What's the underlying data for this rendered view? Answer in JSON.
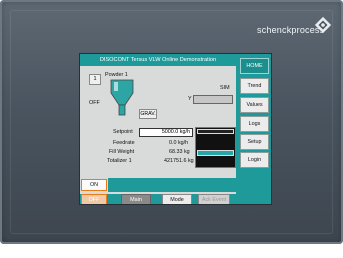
{
  "brand": {
    "name": "schenckprocess"
  },
  "screen": {
    "title": "DISOCONT Tersus VLW Online Demonstration",
    "feeder_number": "1",
    "feeder_name": "Powder 1",
    "mode_label": "SIM",
    "state_label": "OFF",
    "grav_button": "GRAV.",
    "y_label": "Y",
    "setpoint_label": "Setpoint",
    "setpoint_value": "5000.0 kg/h",
    "feedrate_label": "Feedrate",
    "feedrate_value": "0.0 kg/h",
    "fill_weight_label": "Fill Weight",
    "fill_weight_value": "68.33 kg",
    "totalizer_label": "Totalizer 1",
    "totalizer_value": "421751.6 kg",
    "fill_level_fraction": 1.0
  },
  "sidebar": {
    "items": [
      {
        "label": "HOME",
        "active": true
      },
      {
        "label": "Trend",
        "active": false
      },
      {
        "label": "Values",
        "active": false
      },
      {
        "label": "Logs",
        "active": false
      },
      {
        "label": "Setup",
        "active": false
      },
      {
        "label": "Login",
        "active": false
      }
    ]
  },
  "buttons": {
    "on": "ON",
    "off": "OFF",
    "main": "Main",
    "mode": "Mode",
    "ack_event": "Ack Event"
  },
  "colors": {
    "accent": "#1f9a9a",
    "on_off_border": "#e67c19"
  }
}
